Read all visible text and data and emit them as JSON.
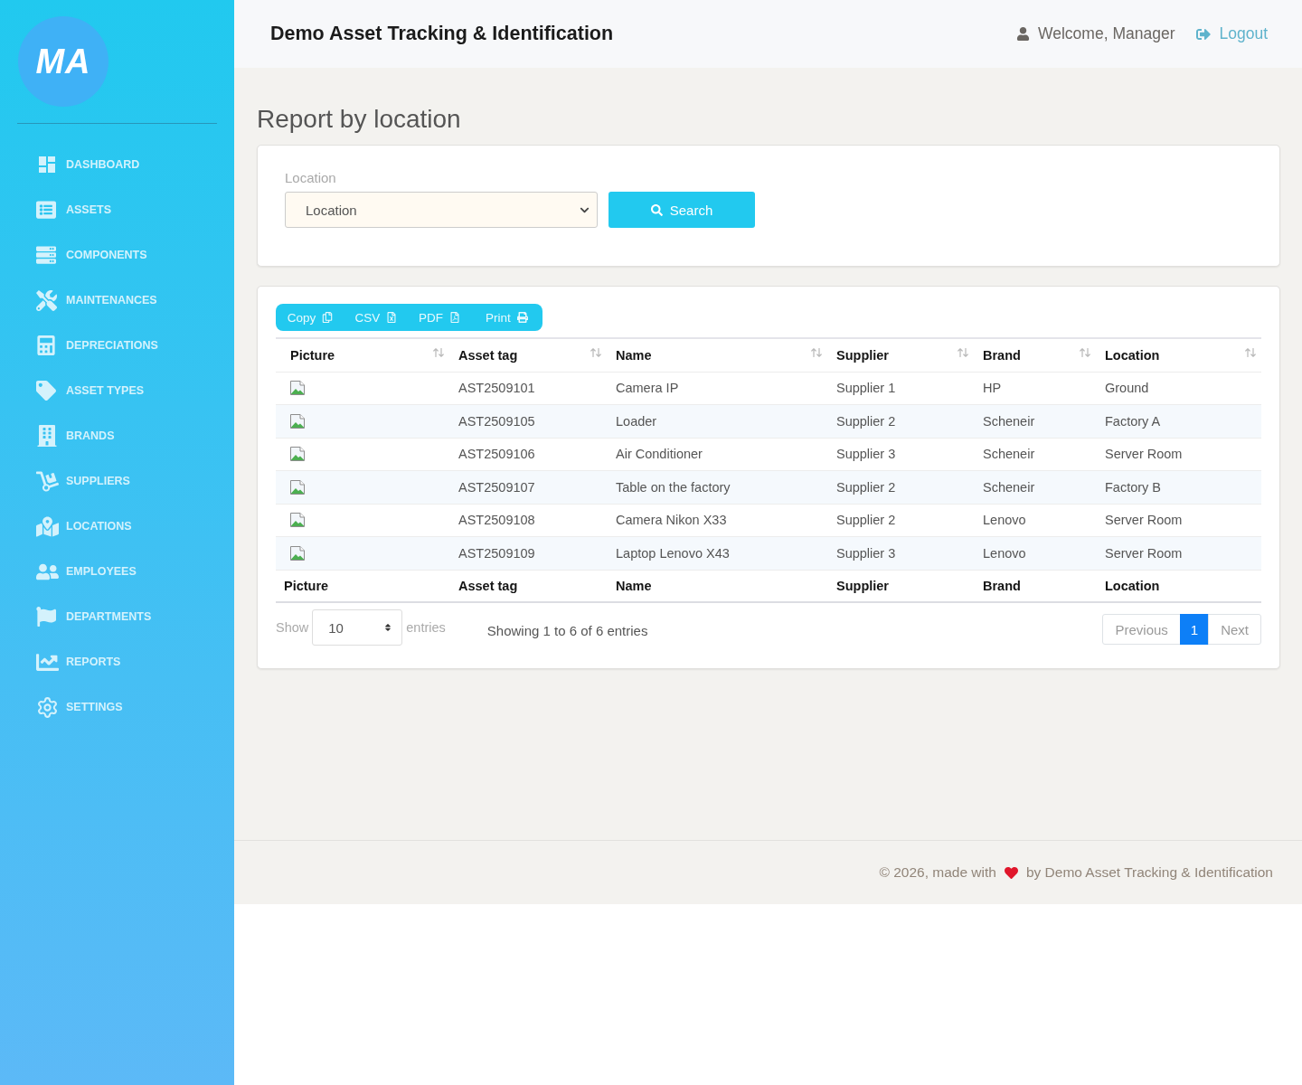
{
  "sidebar": {
    "logo": "MA",
    "items": [
      "DASHBOARD",
      "ASSETS",
      "COMPONENTS",
      "MAINTENANCES",
      "DEPRECIATIONS",
      "ASSET TYPES",
      "BRANDS",
      "SUPPLIERS",
      "LOCATIONS",
      "EMPLOYEES",
      "DEPARTMENTS",
      "REPORTS",
      "SETTINGS"
    ]
  },
  "header": {
    "title": "Demo Asset Tracking & Identification",
    "welcome": "Welcome, Manager",
    "logout": "Logout"
  },
  "page_title": "Report by location",
  "filter": {
    "label": "Location",
    "select": {
      "value": "Location"
    },
    "button": "Search"
  },
  "export_buttons": [
    "Copy",
    "CSV",
    "PDF",
    "Print"
  ],
  "table": {
    "columns": [
      "Picture",
      "Asset tag",
      "Name",
      "Supplier",
      "Brand",
      "Location"
    ],
    "rows": [
      [
        "",
        "AST2509101",
        "Camera IP",
        "Supplier 1",
        "HP",
        "Ground"
      ],
      [
        "",
        "AST2509105",
        "Loader",
        "Supplier 2",
        "Scheneir",
        "Factory A"
      ],
      [
        "",
        "AST2509106",
        "Air Conditioner",
        "Supplier 3",
        "Scheneir",
        "Server Room"
      ],
      [
        "",
        "AST2509107",
        "Table on the factory",
        "Supplier 2",
        "Scheneir",
        "Factory B"
      ],
      [
        "",
        "AST2509108",
        "Camera Nikon X33",
        "Supplier 2",
        "Lenovo",
        "Server Room"
      ],
      [
        "",
        "AST2509109",
        "Laptop Lenovo X43",
        "Supplier 3",
        "Lenovo",
        "Server Room"
      ]
    ],
    "footer": [
      "Picture",
      "Asset tag",
      "Name",
      "Supplier",
      "Brand",
      "Location"
    ]
  },
  "length_menu": {
    "label_before": "Show",
    "value": "10",
    "label_after": "entries"
  },
  "info": "Showing 1 to 6 of 6 entries",
  "pagination": [
    {
      "label": "Previous",
      "selected": false,
      "disabled": true
    },
    {
      "label": "1",
      "selected": true,
      "disabled": false
    },
    {
      "label": "Next",
      "selected": false,
      "disabled": true
    }
  ],
  "footer": {
    "before": "© 2026, made with",
    "after": "by Demo Asset Tracking & Identification"
  }
}
